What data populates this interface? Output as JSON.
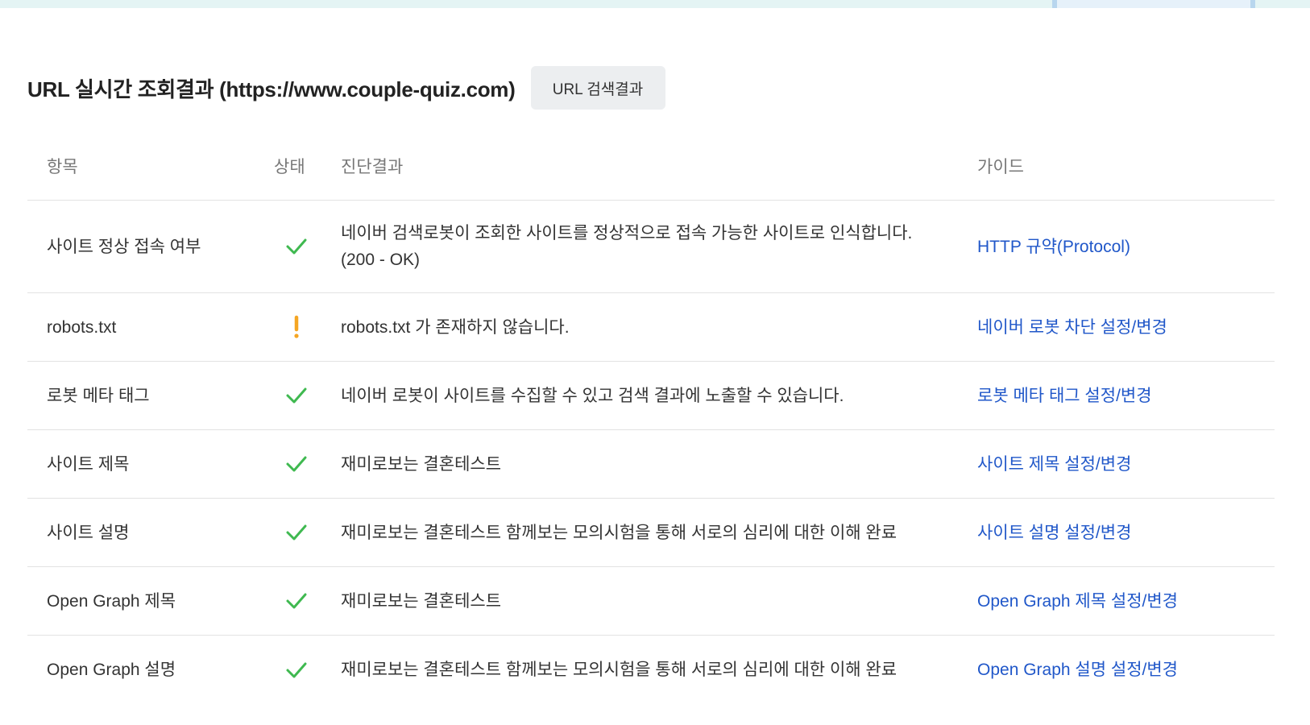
{
  "header": {
    "title": "URL 실시간 조회결과 (https://www.couple-quiz.com)",
    "search_button_label": "URL 검색결과"
  },
  "table": {
    "columns": {
      "item": "항목",
      "status": "상태",
      "result": "진단결과",
      "guide": "가이드"
    },
    "rows": [
      {
        "item": "사이트 정상 접속 여부",
        "status_icon": "check-icon",
        "result": "네이버 검색로봇이 조회한 사이트를 정상적으로 접속 가능한 사이트로 인식합니다.",
        "result_detail": "(200 - OK)",
        "guide": "HTTP 규약(Protocol)"
      },
      {
        "item": "robots.txt",
        "status_icon": "warning-icon",
        "result": "robots.txt 가 존재하지 않습니다.",
        "guide": "네이버 로봇 차단 설정/변경"
      },
      {
        "item": "로봇 메타 태그",
        "status_icon": "check-icon",
        "result": "네이버 로봇이 사이트를 수집할 수 있고 검색 결과에 노출할 수 있습니다.",
        "guide": "로봇 메타 태그 설정/변경"
      },
      {
        "item": "사이트 제목",
        "status_icon": "check-icon",
        "result": "재미로보는 결혼테스트",
        "guide": "사이트 제목 설정/변경"
      },
      {
        "item": "사이트 설명",
        "status_icon": "check-icon",
        "result": "재미로보는 결혼테스트 함께보는 모의시험을 통해 서로의 심리에 대한 이해 완료",
        "guide": "사이트 설명 설정/변경"
      },
      {
        "item": "Open Graph 제목",
        "status_icon": "check-icon",
        "result": "재미로보는 결혼테스트",
        "guide": "Open Graph 제목 설정/변경"
      },
      {
        "item": "Open Graph 설명",
        "status_icon": "check-icon",
        "result": "재미로보는 결혼테스트 함께보는 모의시험을 통해 서로의 심리에 대한 이해 완료",
        "guide": "Open Graph 설명 설정/변경"
      }
    ]
  },
  "colors": {
    "ok": "#3fb950",
    "warning": "#f5a623",
    "link": "#2057c9"
  }
}
